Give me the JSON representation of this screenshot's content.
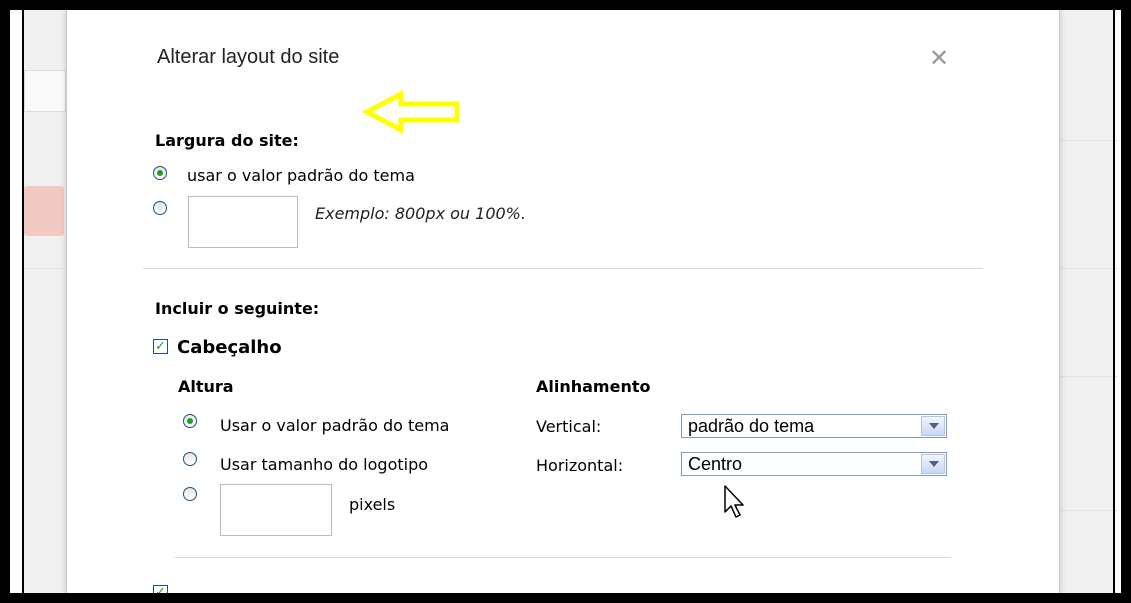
{
  "dialog": {
    "title": "Alterar layout do site",
    "close_icon": "close-icon"
  },
  "site_width": {
    "heading": "Largura do site:",
    "option_default_label": "usar o valor padrão do tema",
    "option_custom_hint": "Exemplo: 800px ou 100%.",
    "custom_value": ""
  },
  "include": {
    "heading": "Incluir o seguinte:",
    "header_checkbox_label": "Cabeçalho",
    "header_checked": true,
    "height": {
      "heading": "Altura",
      "option_default": "Usar o valor padrão do tema",
      "option_logo": "Usar tamanho do logotipo",
      "pixels_label": "pixels",
      "pixels_value": ""
    },
    "alignment": {
      "heading": "Alinhamento",
      "vertical_label": "Vertical:",
      "vertical_value": "padrão do tema",
      "horizontal_label": "Horizontal:",
      "horizontal_value": "Centro"
    }
  },
  "colors": {
    "accent_arrow": "#ffff00",
    "radio_selected": "#21a121"
  }
}
